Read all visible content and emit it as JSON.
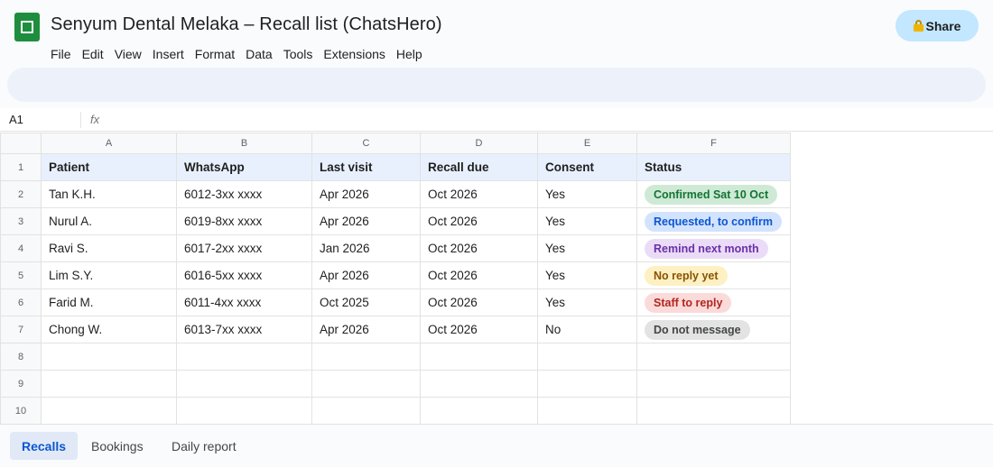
{
  "app": {
    "title": "Senyum Dental Melaka – Recall list (ChatsHero)",
    "share_label": "Share"
  },
  "menu": [
    "File",
    "Edit",
    "View",
    "Insert",
    "Format",
    "Data",
    "Tools",
    "Extensions",
    "Help"
  ],
  "formula_bar": {
    "cell_ref": "A1",
    "fx_label": "fx"
  },
  "grid": {
    "columns": [
      "A",
      "B",
      "C",
      "D",
      "E",
      "F"
    ],
    "row_numbers": [
      "1",
      "2",
      "3",
      "4",
      "5",
      "6",
      "7",
      "8",
      "9",
      "10"
    ],
    "headers": [
      "Patient",
      "WhatsApp",
      "Last visit",
      "Recall due",
      "Consent",
      "Status"
    ],
    "rows": [
      {
        "patient": "Tan K.H.",
        "whatsapp": "6012-3xx xxxx",
        "last_visit": "Apr 2026",
        "recall_due": "Oct 2026",
        "consent": "Yes",
        "status": "Confirmed Sat 10 Oct",
        "status_bg": "#ceead6",
        "status_fg": "#137333"
      },
      {
        "patient": "Nurul A.",
        "whatsapp": "6019-8xx xxxx",
        "last_visit": "Apr 2026",
        "recall_due": "Oct 2026",
        "consent": "Yes",
        "status": "Requested, to confirm",
        "status_bg": "#d3e3fd",
        "status_fg": "#0b57d0"
      },
      {
        "patient": "Ravi S.",
        "whatsapp": "6017-2xx xxxx",
        "last_visit": "Jan 2026",
        "recall_due": "Oct 2026",
        "consent": "Yes",
        "status": "Remind next month",
        "status_bg": "#eadcf7",
        "status_fg": "#6b2fa8"
      },
      {
        "patient": "Lim S.Y.",
        "whatsapp": "6016-5xx xxxx",
        "last_visit": "Apr 2026",
        "recall_due": "Oct 2026",
        "consent": "Yes",
        "status": "No reply yet",
        "status_bg": "#fdf0c3",
        "status_fg": "#8a5300"
      },
      {
        "patient": "Farid M.",
        "whatsapp": "6011-4xx xxxx",
        "last_visit": "Oct 2025",
        "recall_due": "Oct 2026",
        "consent": "Yes",
        "status": "Staff to reply",
        "status_bg": "#fbdada",
        "status_fg": "#b3261e"
      },
      {
        "patient": "Chong W.",
        "whatsapp": "6013-7xx xxxx",
        "last_visit": "Apr 2026",
        "recall_due": "Oct 2026",
        "consent": "No",
        "status": "Do not message",
        "status_bg": "#e3e3e3",
        "status_fg": "#444746"
      }
    ]
  },
  "sheets": [
    {
      "label": "Recalls",
      "active": true
    },
    {
      "label": "Bookings",
      "active": false
    },
    {
      "label": "Daily report",
      "active": false
    }
  ]
}
